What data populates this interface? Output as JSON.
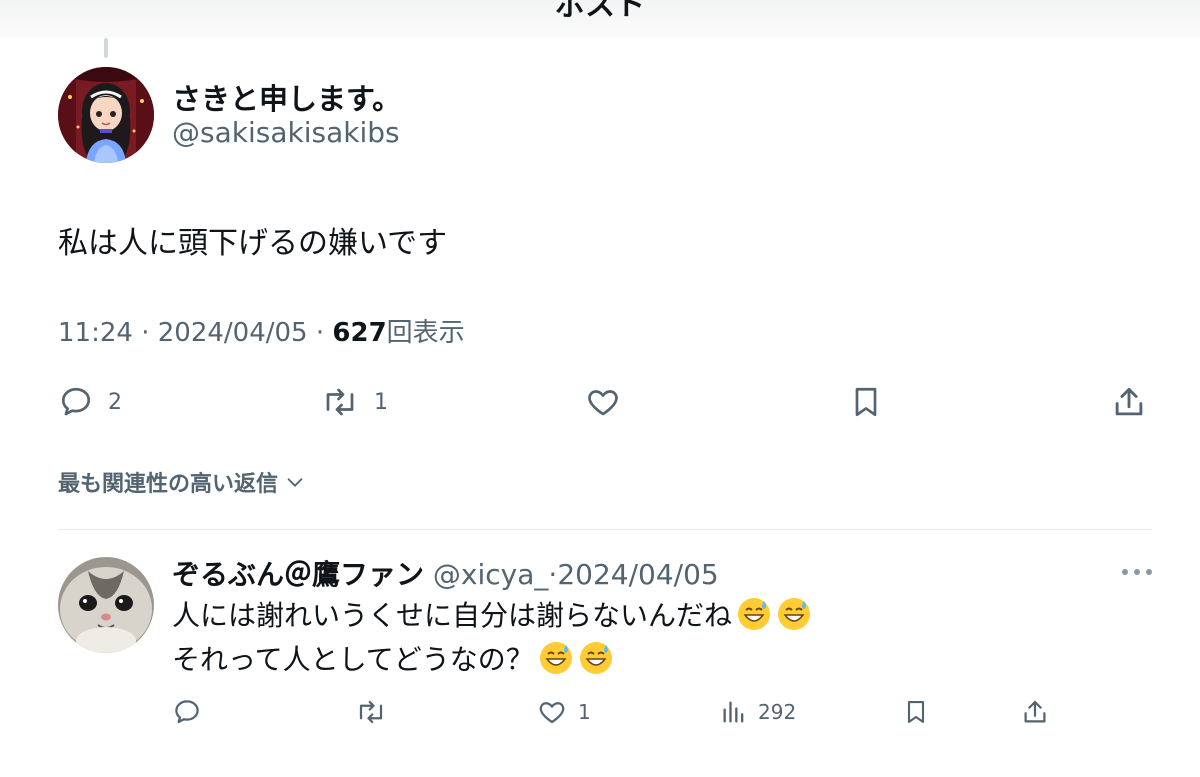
{
  "header": {
    "title": "ポスト"
  },
  "post": {
    "author_name": "さきと申します。",
    "author_handle": "@sakisakisakibs",
    "text": "私は人に頭下げるの嫌いです",
    "time": "11:24",
    "date": "2024/04/05",
    "separator": "·",
    "views_count": "627",
    "views_label": "回表示",
    "actions": {
      "reply_count": "2",
      "repost_count": "1",
      "like_count": "",
      "bookmark_count": "",
      "share_count": ""
    }
  },
  "replies_sort": {
    "label": "最も関連性の高い返信"
  },
  "reply": {
    "author_name": "ぞるぶん＠鷹ファン",
    "author_handle": "@xicya_",
    "separator": "·",
    "date": "2024/04/05",
    "line1": "人には謝れいうくせに自分は謝らないんだね",
    "line2": "それって人としてどうなの？",
    "emoji": "grinning-face-with-sweat",
    "actions": {
      "reply_count": "",
      "repost_count": "",
      "like_count": "1",
      "views_count": "292"
    }
  },
  "colors": {
    "text_primary": "#0f1419",
    "text_secondary": "#536471",
    "divider": "#e6e9eb"
  }
}
